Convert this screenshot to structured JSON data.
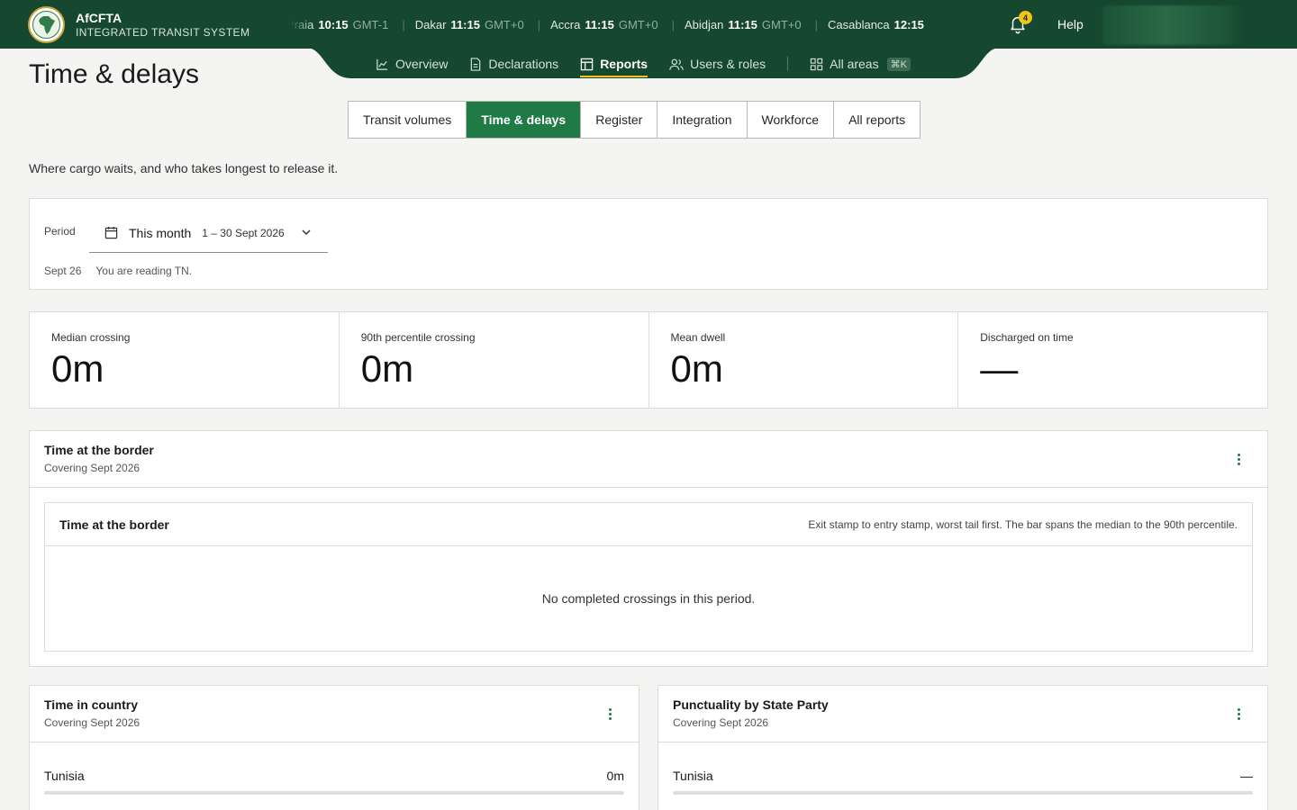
{
  "brand": {
    "name": "AfCFTA",
    "tagline": "INTEGRATED TRANSIT SYSTEM"
  },
  "clocks": [
    {
      "city": "Praia",
      "time": "10:15",
      "tz": "GMT-1"
    },
    {
      "city": "Dakar",
      "time": "11:15",
      "tz": "GMT+0"
    },
    {
      "city": "Accra",
      "time": "11:15",
      "tz": "GMT+0"
    },
    {
      "city": "Abidjan",
      "time": "11:15",
      "tz": "GMT+0"
    },
    {
      "city": "Casablanca",
      "time": "12:15",
      "tz": ""
    }
  ],
  "notifications": {
    "count": "4"
  },
  "help_label": "Help",
  "nav": {
    "overview": "Overview",
    "declarations": "Declarations",
    "reports": "Reports",
    "users": "Users & roles",
    "all_areas": "All areas",
    "shortcut": "⌘K"
  },
  "page": {
    "title": "Time & delays",
    "subtitle": "Where cargo waits, and who takes longest to release it."
  },
  "tabs": [
    "Transit volumes",
    "Time & delays",
    "Register",
    "Integration",
    "Workforce",
    "All reports"
  ],
  "active_tab": "Time & delays",
  "period": {
    "label": "Period",
    "value": "This month",
    "range": "1 – 30 Sept 2026",
    "foot_date": "Sept 26",
    "foot_note": "You are reading TN."
  },
  "kpis": [
    {
      "label": "Median crossing",
      "value": "0m"
    },
    {
      "label": "90th percentile crossing",
      "value": "0m"
    },
    {
      "label": "Mean dwell",
      "value": "0m"
    },
    {
      "label": "Discharged on time",
      "value": "—"
    }
  ],
  "border_section": {
    "title": "Time at the border",
    "subtitle": "Covering Sept 2026",
    "inner_title": "Time at the border",
    "hint": "Exit stamp to entry stamp, worst tail first. The bar spans the median to the 90th percentile.",
    "empty": "No completed crossings in this period."
  },
  "country_section": {
    "title": "Time in country",
    "subtitle": "Covering Sept 2026",
    "rows": [
      {
        "label": "Tunisia",
        "value": "0m"
      }
    ]
  },
  "punctuality_section": {
    "title": "Punctuality by State Party",
    "subtitle": "Covering Sept 2026",
    "rows": [
      {
        "label": "Tunisia",
        "value": "—"
      }
    ]
  },
  "colors": {
    "header": "#16472f",
    "accent": "#1f7a45",
    "badge": "#f2c318"
  }
}
